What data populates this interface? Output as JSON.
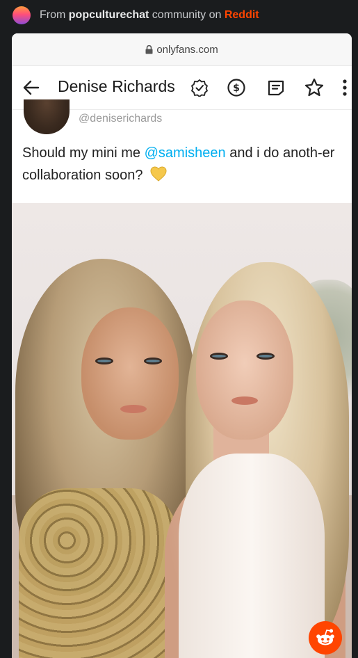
{
  "share_bar": {
    "prefix": "From",
    "community": "popculturechat",
    "middle": "community on",
    "platform": "Reddit"
  },
  "browser": {
    "url": "onlyfans.com"
  },
  "profile": {
    "name": "Denise Richards"
  },
  "post": {
    "handle": "@deniserichards",
    "text_before": "Should my mini me ",
    "mention": "@samisheen",
    "text_after": " and i do anoth-er collaboration soon?"
  },
  "icons": {
    "back": "arrow-left-icon",
    "verified": "verified-badge-icon",
    "tip": "dollar-circle-icon",
    "notes": "notes-icon",
    "favorite": "star-icon",
    "more": "more-vertical-icon",
    "lock": "lock-icon",
    "heart": "yellow-heart-icon",
    "reddit": "reddit-snoo-icon"
  },
  "colors": {
    "page_bg": "#1a1c1e",
    "reddit": "#ff4500",
    "mention": "#00aff0",
    "heart": "#f5c84c"
  }
}
